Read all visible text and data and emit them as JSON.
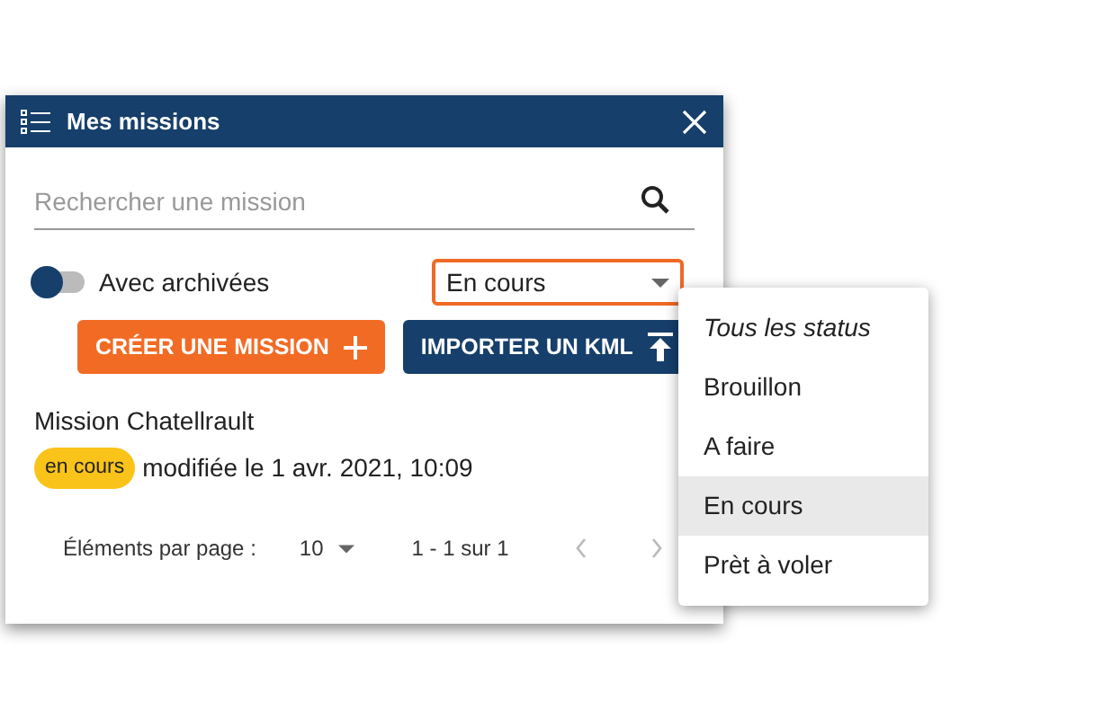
{
  "window": {
    "title": "Mes missions"
  },
  "search": {
    "placeholder": "Rechercher une mission"
  },
  "archived_toggle": {
    "label": "Avec archivées",
    "checked": false
  },
  "status_select": {
    "value": "En cours",
    "open": true
  },
  "buttons": [
    {
      "label": "CRÉER UNE MISSION",
      "kind": "create"
    },
    {
      "label": "IMPORTER UN KML",
      "kind": "import"
    }
  ],
  "missions": [
    {
      "name": "Mission Chatellrault",
      "status": "en cours",
      "modified": "modifiée le 1 avr. 2021, 10:09"
    }
  ],
  "paginator": {
    "label": "Éléments par page :",
    "page_size": "10",
    "range": "1 - 1 sur 1",
    "prev_disabled": true,
    "next_disabled": true
  },
  "status_menu": [
    {
      "label": "Tous les status",
      "kind": "all",
      "selected": false
    },
    {
      "label": "Brouillon",
      "kind": "status",
      "selected": false
    },
    {
      "label": "A faire",
      "kind": "status",
      "selected": false
    },
    {
      "label": "En cours",
      "kind": "status",
      "selected": true
    },
    {
      "label": "Prèt à voler",
      "kind": "status",
      "selected": false
    }
  ]
}
